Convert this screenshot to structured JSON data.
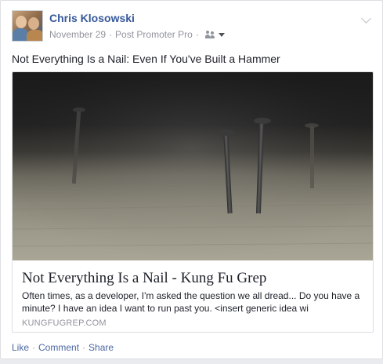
{
  "post": {
    "author": "Chris Klosowski",
    "date": "November 29",
    "separator": "·",
    "app": "Post Promoter Pro",
    "audience_icon": "friends-icon",
    "text": "Not Everything Is a Nail: Even If You've Built a Hammer"
  },
  "link_preview": {
    "image_icon": "nails-photo",
    "title": "Not Everything Is a Nail - Kung Fu Grep",
    "description": "Often times, as a developer, I'm asked the question we all dread... Do you have a minute? I have an idea I want to run past you. <insert generic idea wi",
    "domain": "KUNGFUGREP.COM"
  },
  "actions": {
    "like": "Like",
    "comment": "Comment",
    "share": "Share",
    "separator": "·"
  },
  "colors": {
    "link_blue": "#365899",
    "meta_gray": "#90949c",
    "action_blue": "#4b67a1"
  }
}
